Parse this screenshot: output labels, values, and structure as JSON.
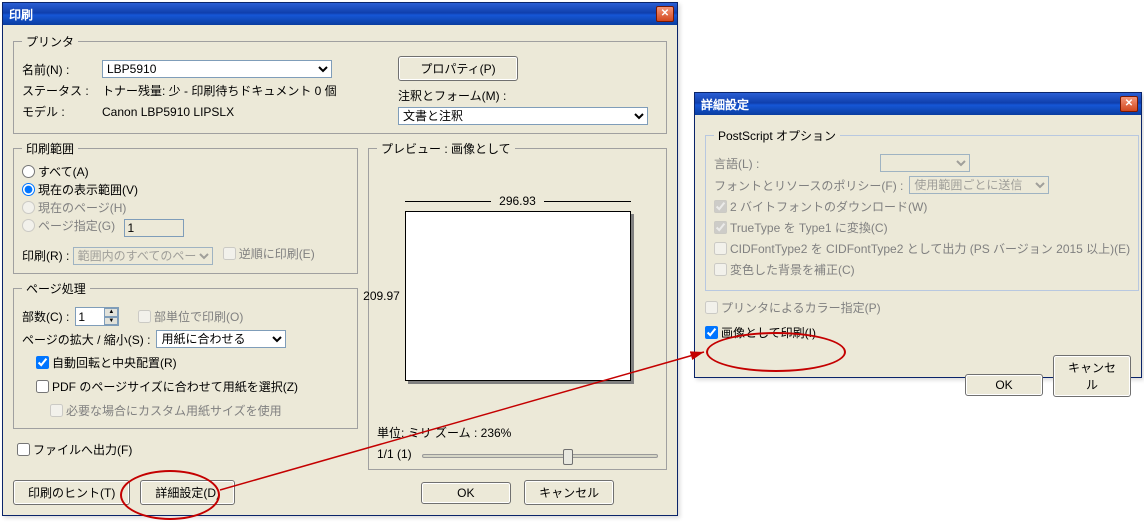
{
  "print": {
    "title": "印刷",
    "printer_group": "プリンタ",
    "name_label": "名前(N) :",
    "name_value": "LBP5910",
    "status_label": "ステータス :",
    "status_value": "トナー残量: 少 - 印刷待ちドキュメント 0 個",
    "model_label": "モデル :",
    "model_value": "Canon LBP5910 LIPSLX",
    "properties_btn": "プロパティ(P)",
    "comments_group_label": "注釈とフォーム(M) :",
    "comments_value": "文書と注釈",
    "range_group": "印刷範囲",
    "range_all": "すべて(A)",
    "range_view": "現在の表示範囲(V)",
    "range_page": "現在のページ(H)",
    "range_pages": "ページ指定(G)",
    "range_pages_value": "1",
    "print_subset_label": "印刷(R) :",
    "print_subset_value": "範囲内のすべてのページ",
    "reverse_label": "逆順に印刷(E)",
    "pagehandling_group": "ページ処理",
    "copies_label": "部数(C) :",
    "copies_value": "1",
    "collate_label": "部単位で印刷(O)",
    "scale_label": "ページの拡大 / 縮小(S) :",
    "scale_value": "用紙に合わせる",
    "auto_rotate_label": "自動回転と中央配置(R)",
    "choose_paper_label": "PDF のページサイズに合わせて用紙を選択(Z)",
    "custom_paper_label": "必要な場合にカスタム用紙サイズを使用",
    "output_to_file_label": "ファイルへ出力(F)",
    "hint_btn": "印刷のヒント(T)",
    "advanced_btn": "詳細設定(D)",
    "ok_btn": "OK",
    "cancel_btn": "キャンセル",
    "preview_label": "プレビュー : 画像として",
    "preview_width": "296.93",
    "preview_height": "209.97",
    "units_zoom": "単位: ミリ ズーム : 236%",
    "page_indicator": "1/1 (1)"
  },
  "advanced": {
    "title": "詳細設定",
    "ps_group": "PostScript オプション",
    "lang_label": "言語(L) :",
    "policy_label": "フォントとリソースのポリシー(F) :",
    "policy_value": "使用範囲ごとに送信",
    "dl2byte_label": "2 バイトフォントのダウンロード(W)",
    "tt2t1_label": "TrueType を Type1 に変換(C)",
    "cid_label": "CIDFontType2 を CIDFontType2 として出力 (PS バージョン 2015 以上)(E)",
    "bgfix_label": "変色した背景を補正(C)",
    "printer_color_label": "プリンタによるカラー指定(P)",
    "print_as_image_label": "画像として印刷(I)",
    "ok_btn": "OK",
    "cancel_btn": "キャンセル"
  }
}
